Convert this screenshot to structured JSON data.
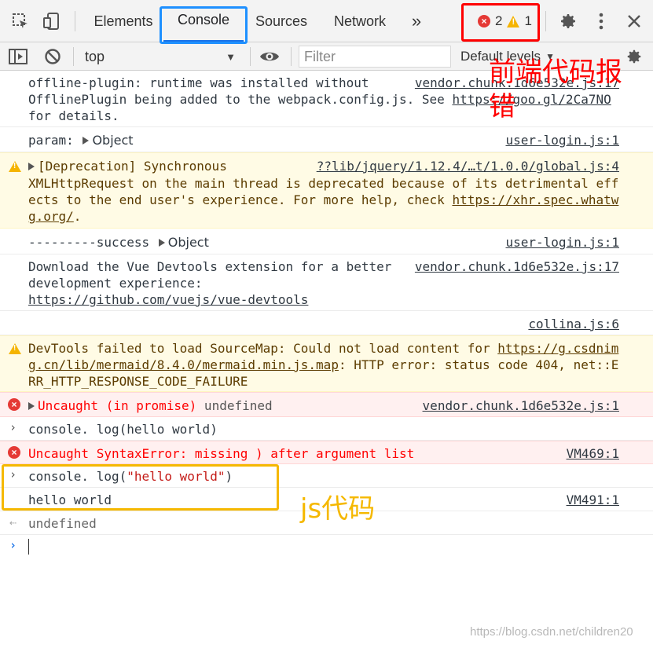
{
  "devtools": {
    "tabs": [
      {
        "label": "Elements"
      },
      {
        "label": "Console"
      },
      {
        "label": "Sources"
      },
      {
        "label": "Network"
      }
    ],
    "more_tabs_label": "»",
    "error_count": "2",
    "warning_count": "1"
  },
  "filterbar": {
    "context": "top",
    "filter_placeholder": "Filter",
    "levels": "Default levels"
  },
  "messages": {
    "m1": {
      "text": "offline-plugin: runtime was installed without    \nOfflinePlugin being added to the webpack.config.js. See ",
      "link": "https://goo.gl/2Ca7NO",
      "text_after": " for details.",
      "source": "vendor.chunk.1d6e532e.js:17"
    },
    "m2": {
      "text": "param: ",
      "object": "Object",
      "source": "user-login.js:1"
    },
    "m3": {
      "text": "[Deprecation] Synchronous",
      "text2": "XMLHttpRequest on the main thread is deprecated because of its detrimental effects to the end user's experience. For more help, check ",
      "link": "https://xhr.spec.whatwg.org/",
      "text_after": ".",
      "source": "??lib/jquery/1.12.4/…t/1.0.0/global.js:4"
    },
    "m4": {
      "text": "---------success ",
      "object": "Object",
      "source": "user-login.js:1"
    },
    "m5": {
      "text": "Download the Vue Devtools extension for a better\ndevelopment experience:\n",
      "link": "https://github.com/vuejs/vue-devtools",
      "source": "vendor.chunk.1d6e532e.js:17"
    },
    "m6": {
      "source": "collina.js:6"
    },
    "m7": {
      "text": "DevTools failed to load SourceMap: Could not load content for ",
      "link": "https://g.csdnimg.cn/lib/mermaid/8.4.0/mermaid.min.js.map",
      "text_after": ": HTTP error: status code 404, net::ERR_HTTP_RESPONSE_CODE_FAILURE"
    },
    "m8": {
      "text": "Uncaught (in promise)",
      "text2": " undefined",
      "source": "vendor.chunk.1d6e532e.js:1"
    },
    "m9": {
      "text": "console. log(hello world)"
    },
    "m10": {
      "text": "Uncaught SyntaxError: missing ) after argument list",
      "source": "VM469:1"
    },
    "m11": {
      "text_pre": "console. log(",
      "string": "\"hello world\"",
      "text_post": ")"
    },
    "m12": {
      "text": "hello world",
      "source": "VM491:1"
    },
    "m13": {
      "text": "undefined"
    }
  },
  "annotations": {
    "frontend_error": "前端代码报\n错",
    "js_code": "js代码",
    "color_red": "#ff0000",
    "color_yellow": "#f5b800",
    "color_blue": "#1e90ff"
  },
  "watermark": "https://blog.csdn.net/children20"
}
